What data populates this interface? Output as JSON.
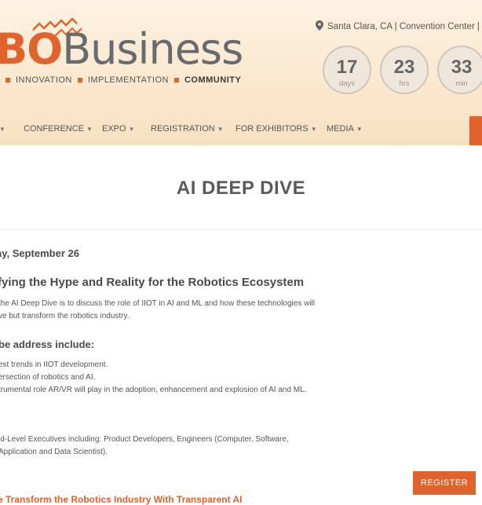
{
  "header": {
    "logo": {
      "part1": "BO",
      "part2": "Business"
    },
    "tagline": [
      "INNOVATION",
      "IMPLEMENTATION",
      "COMMUNITY"
    ],
    "location": "Santa Clara, CA | Convention Center | S",
    "countdown": [
      {
        "value": "17",
        "unit": "days"
      },
      {
        "value": "23",
        "unit": "hrs"
      },
      {
        "value": "33",
        "unit": "min"
      }
    ],
    "nav": [
      {
        "label": "CONFERENCE"
      },
      {
        "label": "EXPO"
      },
      {
        "label": "REGISTRATION"
      },
      {
        "label": "FOR EXHIBITORS"
      },
      {
        "label": "MEDIA"
      }
    ]
  },
  "page": {
    "title": "AI DEEP DIVE",
    "date": "ay, September 26",
    "heading": "fying the Hype and Reality for the Robotics Ecosystem",
    "intro": [
      "the AI Deep Dive is to discuss the role of IIOT in AI and ML and how these technologies will",
      "ve but transform the robotics industry."
    ],
    "topics_heading": "be address include:",
    "topics": [
      "est trends in IIOT development.",
      "ersection of robotics and AI.",
      "trumental role AR/VR will play in the adoption, enhancement and explosion of AI and ML."
    ],
    "audience": [
      "id-Level Executives including: Product Developers, Engineers (Computer, Software,",
      "Application and Data Scientist)."
    ],
    "register_label": "REGISTER",
    "next_link": "e Transform the Robotics Industry With Transparent AI"
  },
  "colors": {
    "accent": "#e0632d",
    "header_bg": "#fbe8cf"
  },
  "icons": [
    "gear-icon",
    "location-pin-icon",
    "chevron-down-icon"
  ]
}
